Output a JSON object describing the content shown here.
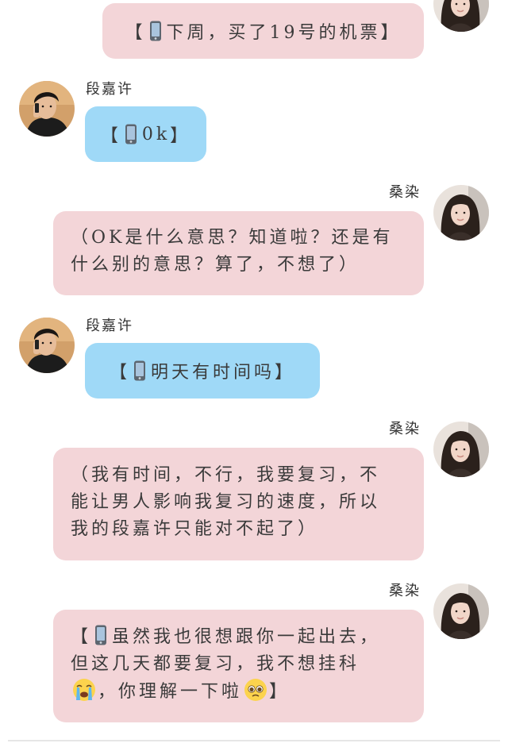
{
  "contacts": {
    "him": {
      "name": "段嘉许"
    },
    "her": {
      "name": "桑染"
    }
  },
  "messages": [
    {
      "sender": "her",
      "show_name": false,
      "bubble_color": "pink",
      "lines": [
        {
          "open": "【",
          "phone_icon": true,
          "text": "下周，买了19号的机票",
          "close": "】"
        }
      ]
    },
    {
      "sender": "him",
      "show_name": true,
      "bubble_color": "blue",
      "lines": [
        {
          "open": "【",
          "phone_icon": true,
          "text": "0k",
          "close": "】"
        }
      ]
    },
    {
      "sender": "her",
      "show_name": true,
      "bubble_color": "pink",
      "lines": [
        "（OK是什么意思？知道啦？还是有",
        "什么别的意思？算了，不想了）"
      ]
    },
    {
      "sender": "him",
      "show_name": true,
      "bubble_color": "blue",
      "lines": [
        {
          "open": "【",
          "phone_icon": true,
          "text": "明天有时间吗",
          "close": "】"
        }
      ]
    },
    {
      "sender": "her",
      "show_name": true,
      "bubble_color": "pink",
      "lines": [
        "（我有时间，不行，我要复习，不",
        "能让男人影响我复习的速度，所以",
        "我的段嘉许只能对不起了）"
      ]
    },
    {
      "sender": "her",
      "show_name": true,
      "bubble_color": "pink",
      "lines": [
        {
          "open": "【",
          "phone_icon": true,
          "text": "虽然我也很想跟你一起出去，",
          "close": ""
        },
        "但这几天都要复习，我不想挂科",
        {
          "emoji_before": "loudly-crying-face-emoji",
          "text": "，你理解一下啦",
          "emoji_after": "pleading-face-emoji",
          "close": "】"
        }
      ]
    }
  ],
  "colors": {
    "pink_bubble": "#f3d5d8",
    "blue_bubble": "#9fd9f7",
    "text": "#3a3a3a",
    "name_text": "#333333"
  }
}
